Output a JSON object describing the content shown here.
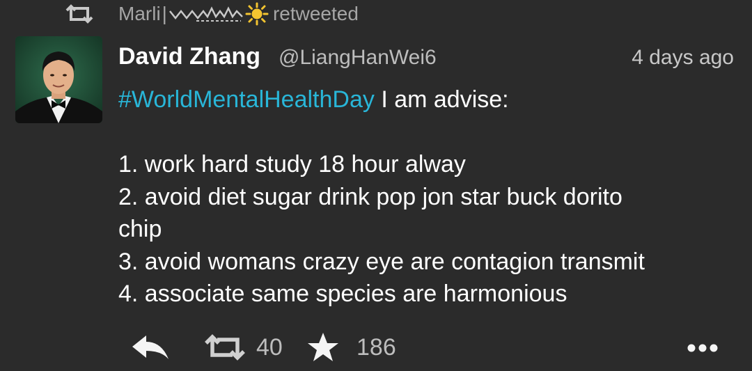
{
  "retweet_bar": {
    "icon": "retweet-icon",
    "retweeter_name": "Marli",
    "separator": "|",
    "decoration_icons": [
      "squiggle-icon",
      "sun-icon"
    ],
    "label": "retweeted"
  },
  "tweet": {
    "avatar": "avatar-photo",
    "author_name": "David Zhang",
    "author_handle": "@LiangHanWei6",
    "timestamp": "4 days ago",
    "hashtag": "#WorldMentalHealthDay",
    "first_line_rest": " I am advise:",
    "blank_line": "",
    "lines": [
      "1. work hard study 18 hour alway",
      "2. avoid diet sugar drink pop jon star buck dorito",
      "chip",
      "3. avoid womans crazy eye are contagion transmit",
      "4. associate same species are harmonious"
    ]
  },
  "actions": {
    "reply_icon": "reply-icon",
    "retweet_icon": "retweet-icon",
    "retweet_count": "40",
    "favorite_icon": "star-icon",
    "favorite_count": "186",
    "more_icon": "more-icon"
  },
  "colors": {
    "background": "#2b2b2b",
    "hashtag": "#29b6d8",
    "muted_text": "#a6a6a6",
    "sun": "#f4c430"
  }
}
